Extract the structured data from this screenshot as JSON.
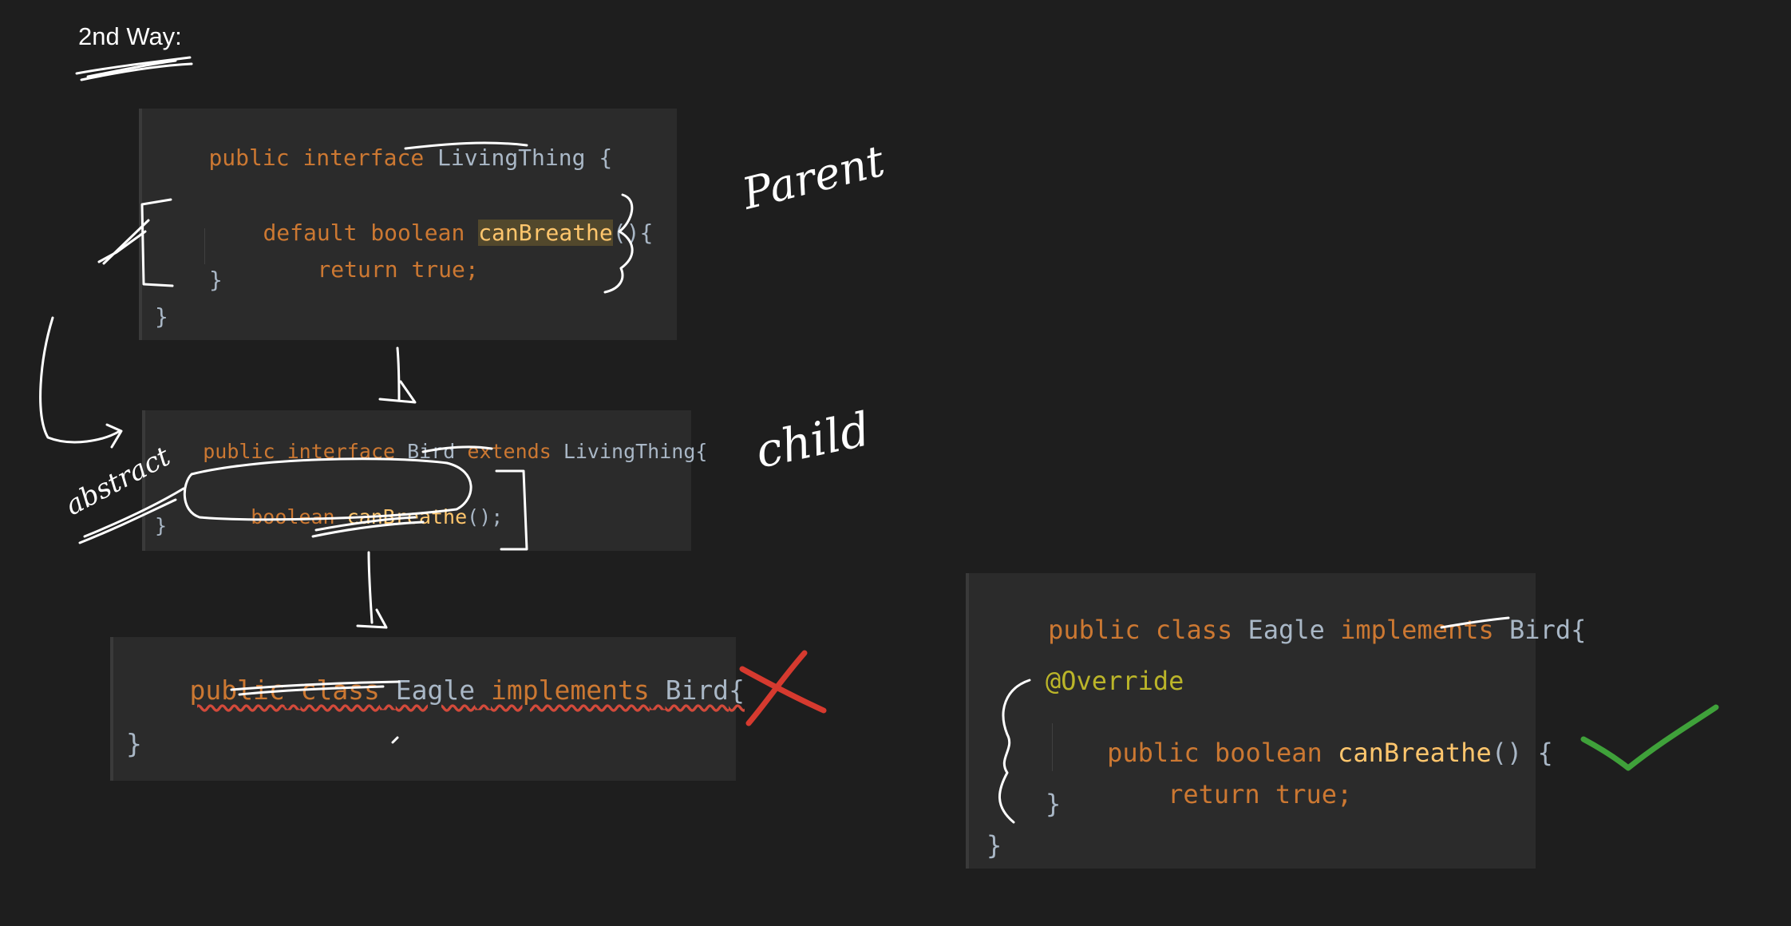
{
  "heading": "2nd Way:",
  "panel1": {
    "line1": {
      "kw1": "public",
      "kw2": "interface",
      "name": "LivingThing",
      "brace": "{"
    },
    "line2": {
      "kw1": "default",
      "kw2": "boolean",
      "method": "canBreathe",
      "parens": "(){"
    },
    "line3": {
      "kw": "return",
      "val": "true",
      "semi": ";"
    },
    "line4": "}",
    "line5": "}"
  },
  "panel2": {
    "line1": {
      "kw1": "public",
      "kw2": "interface",
      "name": "Bird",
      "kw3": "extends",
      "parent": "LivingThing",
      "brace": "{"
    },
    "line2": {
      "kw": "boolean",
      "method": "canBreathe",
      "tail": "();"
    },
    "line3": "}"
  },
  "panel3": {
    "line1": {
      "kw1": "public",
      "kw2": "class",
      "name": "Eagle",
      "kw3": "implements",
      "iface": "Bird",
      "brace": "{"
    },
    "line2": "}"
  },
  "panel4": {
    "line1": {
      "kw1": "public",
      "kw2": "class",
      "name": "Eagle",
      "kw3": "implements",
      "iface": "Bird",
      "brace": "{"
    },
    "line2": "@Override",
    "line3": {
      "kw1": "public",
      "kw2": "boolean",
      "method": "canBreathe",
      "tail": "() {"
    },
    "line4": {
      "kw": "return",
      "val": "true",
      "semi": ";"
    },
    "line5": "}",
    "line6": "}"
  },
  "notes": {
    "parent": "Parent",
    "child": "child",
    "abstract": "abstract"
  },
  "colors": {
    "background": "#1e1e1e",
    "panel": "#2b2b2b",
    "keyword": "#cc7832",
    "method": "#ffc66d",
    "annotation": "#bbb529",
    "identifier": "#a9b7c6",
    "cross_mark": "#d63a2f",
    "check_mark": "#3fa13a"
  }
}
